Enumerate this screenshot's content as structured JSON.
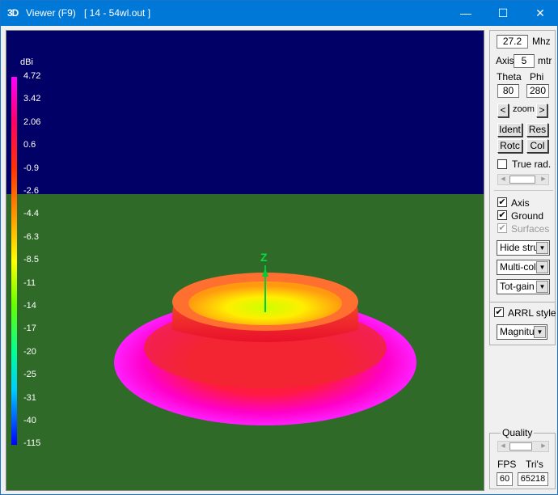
{
  "window": {
    "logo": "3D",
    "title": "Viewer (F9)",
    "file": "[  14 - 54wl.out ]",
    "minimize": "—",
    "maximize": "☐",
    "close": "✕"
  },
  "colorbar": {
    "unit": "dBi",
    "labels": [
      "4.72",
      "3.42",
      "2.06",
      "0.6",
      "-0.9",
      "-2.6",
      "-4.4",
      "-6.3",
      "-8.5",
      "-11",
      "-14",
      "-17",
      "-20",
      "-25",
      "-31",
      "-40",
      "-115"
    ]
  },
  "axis_label": "Z",
  "controls": {
    "freq": "27.2",
    "freq_unit": "Mhz",
    "axis_label": "Axis",
    "axis_value": "5",
    "axis_unit": "mtr",
    "theta_label": "Theta",
    "theta_value": "80",
    "phi_label": "Phi",
    "phi_value": "280",
    "zoom_prev": "<",
    "zoom_label": "zoom",
    "zoom_next": ">",
    "ident": "Ident",
    "res": "Res",
    "rotc": "Rotc",
    "col": "Col",
    "true_rad": "True rad.",
    "axis_chk": "Axis",
    "ground_chk": "Ground",
    "surfaces_chk": "Surfaces",
    "structure_select": "Hide struc",
    "color_select": "Multi-colo",
    "gain_select": "Tot-gain",
    "arrl": "ARRL style",
    "mag_select": "Magnituc"
  },
  "quality": {
    "label": "Quality",
    "fps_label": "FPS",
    "fps": "60",
    "tris_label": "Tri's",
    "tris": "65218"
  }
}
